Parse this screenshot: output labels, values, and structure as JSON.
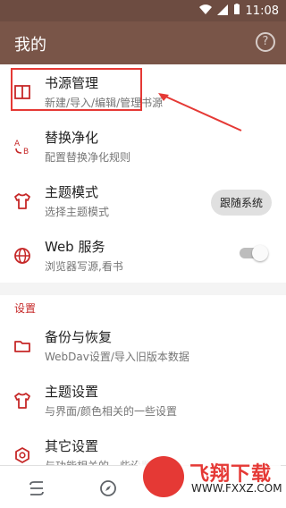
{
  "status_bar": {
    "time": "11:08"
  },
  "app_bar": {
    "title": "我的",
    "help_icon": "help-circle-icon"
  },
  "menu": {
    "items": [
      {
        "title": "书源管理",
        "subtitle": "新建/导入/编辑/管理书源",
        "icon": "book-icon"
      },
      {
        "title": "替换净化",
        "subtitle": "配置替换净化规则",
        "icon": "replace-ab-icon"
      },
      {
        "title": "主题模式",
        "subtitle": "选择主题模式",
        "icon": "tshirt-icon",
        "action_label": "跟随系统"
      },
      {
        "title": "Web 服务",
        "subtitle": "浏览器写源,看书",
        "icon": "globe-icon",
        "toggle": false
      }
    ]
  },
  "settings": {
    "section_title": "设置",
    "items": [
      {
        "title": "备份与恢复",
        "subtitle": "WebDav设置/导入旧版本数据",
        "icon": "folder-icon"
      },
      {
        "title": "主题设置",
        "subtitle": "与界面/颜色相关的一些设置",
        "icon": "tshirt-icon"
      },
      {
        "title": "其它设置",
        "subtitle": "与功能相关的一些设置",
        "icon": "gear-icon"
      }
    ]
  },
  "watermark": {
    "brand": "飞翔下载",
    "domain": "WWW.FXXZ.COM"
  },
  "colors": {
    "app_bar": "#795548",
    "status_bar": "#6d4c41",
    "accent": "#c62828",
    "annotation": "#e53935"
  }
}
